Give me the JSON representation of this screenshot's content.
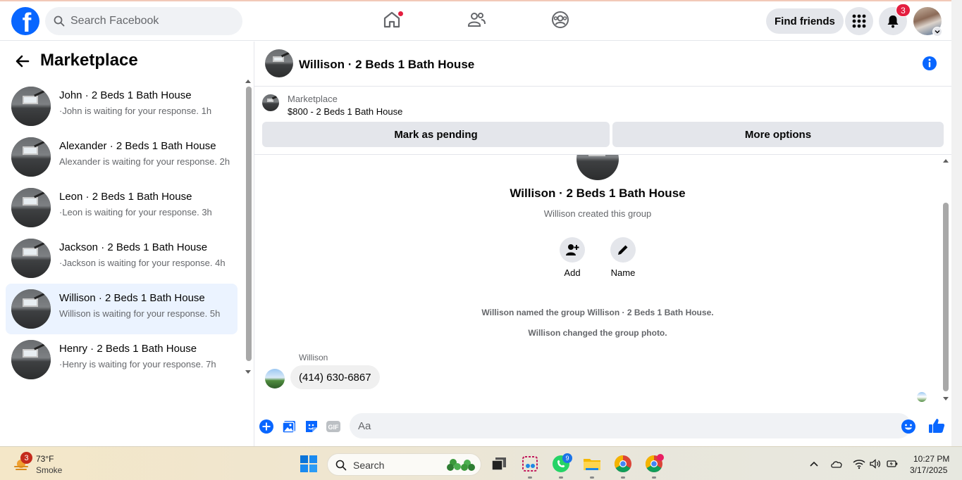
{
  "topbar": {
    "search_placeholder": "Search Facebook",
    "find_friends_label": "Find friends",
    "notifications_count": "3",
    "icons": [
      "facebook-logo",
      "home-icon",
      "friends-icon",
      "groups-icon",
      "menu-grid-icon",
      "bell-icon",
      "profile-avatar"
    ]
  },
  "sidebar": {
    "title": "Marketplace",
    "conversations": [
      {
        "title": "John · 2 Beds 1 Bath House",
        "subtitle": "·John is waiting for your response. 1h",
        "active": false
      },
      {
        "title": "Alexander · 2 Beds 1 Bath House",
        "subtitle": " Alexander is waiting for your response. 2h",
        "active": false
      },
      {
        "title": "Leon · 2 Beds 1 Bath House",
        "subtitle": "·Leon is waiting for your response. 3h",
        "active": false
      },
      {
        "title": "Jackson · 2 Beds 1 Bath House",
        "subtitle": "·Jackson is waiting for your response. 4h",
        "active": false
      },
      {
        "title": "Willison · 2 Beds 1 Bath House",
        "subtitle": " Willison is waiting for your response. 5h",
        "active": true
      },
      {
        "title": "Henry · 2 Beds 1 Bath House",
        "subtitle": "·Henry is waiting for your response. 7h",
        "active": false
      }
    ]
  },
  "chat": {
    "header_title": "Willison · 2 Beds 1 Bath House",
    "listing": {
      "label": "Marketplace",
      "price_title": "$800 - 2 Beds 1 Bath House",
      "pending_button": "Mark as pending",
      "more_button": "More options"
    },
    "group": {
      "title": "Willison · 2 Beds 1 Bath House",
      "created_text": "Willison created this group",
      "add_label": "Add",
      "name_label": "Name"
    },
    "system_messages": [
      "Willison named the group Willison · 2 Beds 1 Bath House.",
      "Willison changed the group photo."
    ],
    "message": {
      "sender": "Willison",
      "text": "(414) 630-6867"
    },
    "composer_placeholder": "Aa"
  },
  "taskbar": {
    "weather_badge": "3",
    "temperature": "73°F",
    "condition": "Smoke",
    "search_label": "Search",
    "whatsapp_badge": "9",
    "time": "10:27 PM",
    "date": "3/17/2025"
  },
  "colors": {
    "accent": "#0866ff",
    "notification": "#e41e3f",
    "active_row": "#ebf3ff",
    "button_bg": "#e4e6eb"
  }
}
